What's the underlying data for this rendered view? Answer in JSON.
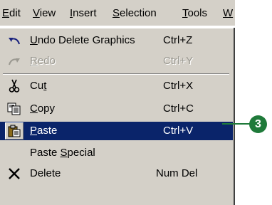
{
  "menubar": {
    "items": [
      {
        "pre": "",
        "u": "E",
        "post": "dit"
      },
      {
        "pre": "",
        "u": "V",
        "post": "iew"
      },
      {
        "pre": "",
        "u": "I",
        "post": "nsert"
      },
      {
        "pre": "",
        "u": "S",
        "post": "election"
      },
      {
        "pre": "",
        "u": "T",
        "post": "ools"
      },
      {
        "pre": "",
        "u": "W",
        "post": ""
      }
    ]
  },
  "menu": {
    "undo": {
      "pre": "",
      "u": "U",
      "post": "ndo Delete Graphics",
      "shortcut": "Ctrl+Z",
      "icon": "undo-icon"
    },
    "redo": {
      "pre": "",
      "u": "R",
      "post": "edo",
      "shortcut": "Ctrl+Y",
      "icon": "redo-icon"
    },
    "cut": {
      "pre": "Cu",
      "u": "t",
      "post": "",
      "shortcut": "Ctrl+X",
      "icon": "scissors-icon"
    },
    "copy": {
      "pre": "",
      "u": "C",
      "post": "opy",
      "shortcut": "Ctrl+C",
      "icon": "copy-icon"
    },
    "paste": {
      "pre": "",
      "u": "P",
      "post": "aste",
      "shortcut": "Ctrl+V",
      "icon": "paste-icon"
    },
    "paste_special": {
      "pre": "Paste ",
      "u": "S",
      "post": "pecial",
      "shortcut": ""
    },
    "delete": {
      "pre": "Delete",
      "u": "",
      "post": "",
      "shortcut": "Num Del",
      "icon": "delete-x-icon"
    }
  },
  "callout": {
    "number": "3"
  },
  "colors": {
    "menu_bg": "#d4d0c8",
    "selection": "#0a246a",
    "callout": "#1f7a3a",
    "disabled": "#9a9890"
  }
}
